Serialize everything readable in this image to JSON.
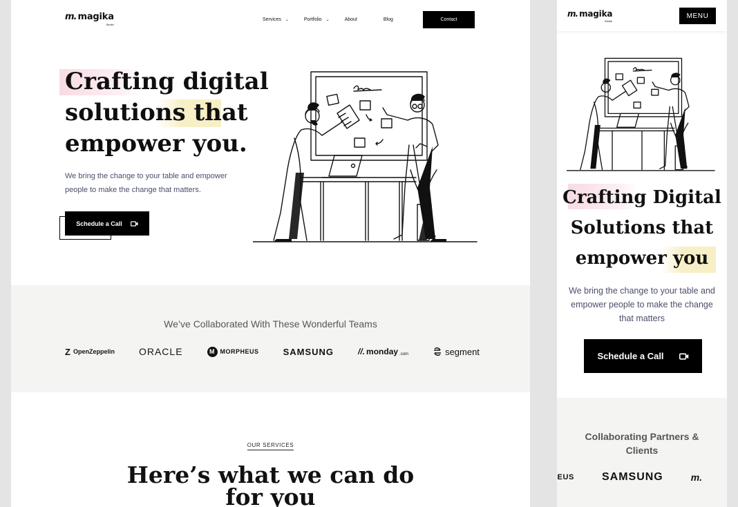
{
  "brand": {
    "logo_mark": "m.",
    "name": "magika",
    "sub": "Studio"
  },
  "nav": {
    "services": "Services",
    "portfolio": "Portfolio",
    "about": "About",
    "blog": "Blog",
    "contact": "Contact"
  },
  "hero": {
    "title_line1": "Crafting digital",
    "title_line2": "solutions that",
    "title_line3": "empower you.",
    "subtitle": "We bring the change to your table and empower people to make the change that matters.",
    "cta": "Schedule a Call"
  },
  "collab": {
    "title": "We’ve Collaborated With These Wonderful Teams",
    "logos": [
      "OpenZeppelin",
      "ORACLE",
      "MORPHEUS",
      "SAMSUNG",
      "monday",
      "segment"
    ],
    "monday_suffix": ".com"
  },
  "services": {
    "label": "OUR SERVICES",
    "title_line1": "Here’s what we can do",
    "title_line2": "for you"
  },
  "mobile": {
    "menu": "MENU",
    "title_line1": "Crafting Digital",
    "title_line2": "Solutions that",
    "title_line3": "empower you",
    "subtitle": "We bring the change to your table and empower people to make the change that matters",
    "cta": "Schedule a Call",
    "collab_title": "Collaborating Partners & Clients",
    "logos": [
      "HEUS",
      "SAMSUNG",
      "m."
    ]
  },
  "colors": {
    "highlight_pink": "#f8dbe2",
    "highlight_yellow": "#f7efc6",
    "section_bg": "#f4f5f3",
    "body_text": "#4a4e69"
  },
  "icons": [
    "chevron-down-icon",
    "video-camera-icon",
    "whiteboard-team-illustration"
  ]
}
